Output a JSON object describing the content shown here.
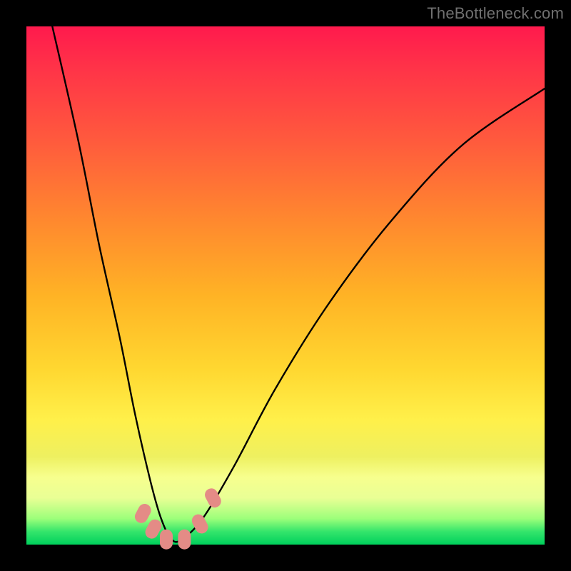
{
  "watermark": "TheBottleneck.com",
  "chart_data": {
    "type": "line",
    "title": "",
    "xlabel": "",
    "ylabel": "",
    "xlim": [
      0,
      100
    ],
    "ylim": [
      0,
      100
    ],
    "grid": false,
    "legend": false,
    "background_gradient": {
      "direction": "vertical",
      "stops": [
        {
          "pct": 0,
          "color": "#ff1a4d"
        },
        {
          "pct": 22,
          "color": "#ff5a3d"
        },
        {
          "pct": 52,
          "color": "#ffb325"
        },
        {
          "pct": 76,
          "color": "#fff04a"
        },
        {
          "pct": 95,
          "color": "#9cff7a"
        },
        {
          "pct": 100,
          "color": "#00d05c"
        }
      ]
    },
    "series": [
      {
        "name": "bottleneck-curve",
        "x": [
          5,
          10,
          14,
          18,
          21,
          24,
          26,
          28,
          30,
          34,
          40,
          48,
          58,
          70,
          84,
          100
        ],
        "y": [
          100,
          78,
          58,
          40,
          25,
          12,
          5,
          1,
          1,
          5,
          15,
          30,
          46,
          62,
          77,
          88
        ]
      }
    ],
    "markers": [
      {
        "name": "highlight-1",
        "x": 22.5,
        "y": 6,
        "color": "#e48b86"
      },
      {
        "name": "highlight-2",
        "x": 24.5,
        "y": 3,
        "color": "#e48b86"
      },
      {
        "name": "highlight-3",
        "x": 27.0,
        "y": 1,
        "color": "#e48b86"
      },
      {
        "name": "highlight-4",
        "x": 30.5,
        "y": 1,
        "color": "#e48b86"
      },
      {
        "name": "highlight-5",
        "x": 33.5,
        "y": 4,
        "color": "#e48b86"
      },
      {
        "name": "highlight-6",
        "x": 36.0,
        "y": 9,
        "color": "#e48b86"
      }
    ]
  }
}
